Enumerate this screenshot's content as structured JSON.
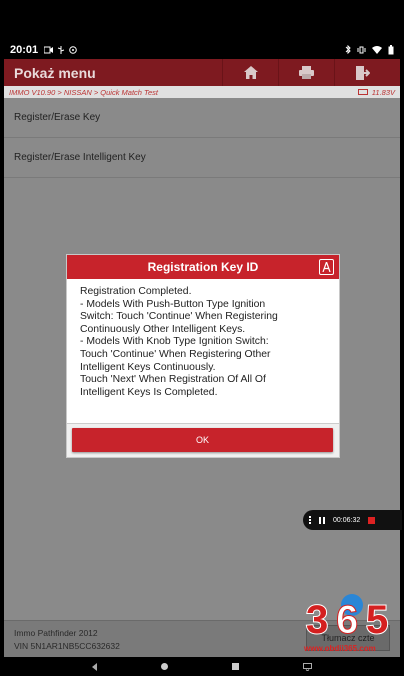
{
  "status_bar": {
    "time": "20:01",
    "left_icons": [
      "video-icon",
      "usb-icon",
      "vpn-icon"
    ],
    "right_icons": [
      "bluetooth-icon",
      "vibrate-icon",
      "wifi-icon",
      "battery-icon"
    ]
  },
  "app_bar": {
    "title": "Pokaż menu",
    "actions": [
      "home-icon",
      "print-icon",
      "exit-icon"
    ]
  },
  "breadcrumb": {
    "path": "IMMO V10.90 > NISSAN > Quick Match Test",
    "voltage": "11.83V"
  },
  "menu_items": [
    "Register/Erase Key",
    "Register/Erase Intelligent Key"
  ],
  "footer": {
    "line1": "Immo Pathfinder 2012",
    "line2": "VIN 5N1AR1NB5CC632632",
    "button_label": "Tłumacz czte"
  },
  "dialog": {
    "title": "Registration Key ID",
    "lines": [
      "Registration Completed.",
      "- Models With Push-Button Type Ignition",
      "Switch: Touch 'Continue' When Registering",
      "Continuously Other Intelligent Keys.",
      "- Models With Knob Type Ignition Switch:",
      "Touch 'Continue' When Registering Other",
      "Intelligent Keys Continuously.",
      "Touch 'Next' When Registration Of All Of",
      "Intelligent Keys Is Completed."
    ],
    "ok_label": "OK"
  },
  "recorder": {
    "elapsed": "00:06:32"
  },
  "watermark": {
    "logo_text": "365",
    "url": "www.obdii365.com"
  },
  "colors": {
    "accent_red": "#c7232b",
    "app_bar_dark_red": "#7e1a20",
    "overlay_gray": "#8a8a8a"
  }
}
